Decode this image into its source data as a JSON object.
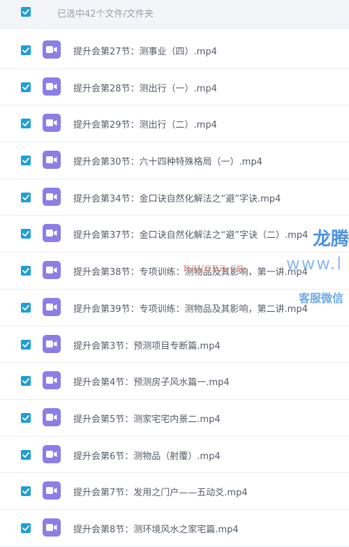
{
  "header": {
    "selection_text": "已选中42个文件/文件夹"
  },
  "files": [
    {
      "name": "提升会第27节：测事业（四）.mp4"
    },
    {
      "name": "提升会第28节：测出行（一）.mp4"
    },
    {
      "name": "提升会第29节：测出行（二）.mp4"
    },
    {
      "name": "提升会第30节：六十四种特殊格局（一）.mp4"
    },
    {
      "name": "提升会第34节：金口诀自然化解法之“避”字诀.mp4"
    },
    {
      "name": "提升会第37节：金口诀自然化解法之“避”字诀（二）.mp4"
    },
    {
      "name": "提升会第38节：专项训练：测物品及其影响，第一讲.mp4"
    },
    {
      "name": "提升会第39节：专项训练：测物品及其影响，第二讲.mp4"
    },
    {
      "name": "提升会第3节：预测项目专断篇.mp4"
    },
    {
      "name": "提升会第4节：预测房子风水篇一.mp4"
    },
    {
      "name": "提升会第5节：测家宅宅内景二.mp4"
    },
    {
      "name": "提升会第6节：测物品（射覆）.mp4"
    },
    {
      "name": "提升会第7节：发用之门户——五动爻.mp4"
    },
    {
      "name": "提升会第8节：测环境风水之家宅篇.mp4"
    }
  ],
  "watermark": {
    "brand": "龙腾",
    "url": "nayona.cn",
    "www": "www.l",
    "service": "客服微信"
  },
  "colors": {
    "checkbox": "#1e9fd8",
    "video_icon": "#8b7ee6"
  },
  "icons": {
    "checkbox": "checkbox-checked-icon",
    "file": "video-file-icon"
  }
}
